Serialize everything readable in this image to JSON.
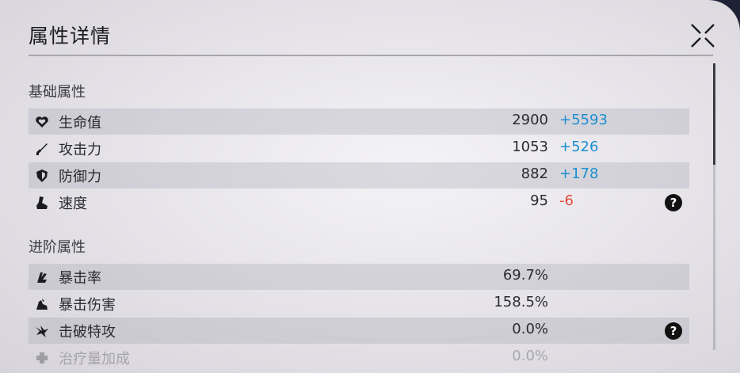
{
  "panel": {
    "title": "属性详情",
    "close_icon": "close-x-icon",
    "scroll_position": 0.0
  },
  "basic": {
    "heading": "基础属性",
    "rows": [
      {
        "label": "生命值",
        "value": "2900",
        "bonus": "+5593",
        "bonus_sign": "pos",
        "icon": "heart-icon",
        "help": false
      },
      {
        "label": "攻击力",
        "value": "1053",
        "bonus": "+526",
        "bonus_sign": "pos",
        "icon": "sword-icon",
        "help": false
      },
      {
        "label": "防御力",
        "value": "882",
        "bonus": "+178",
        "bonus_sign": "pos",
        "icon": "shield-icon",
        "help": false
      },
      {
        "label": "速度",
        "value": "95",
        "bonus": "-6",
        "bonus_sign": "neg",
        "icon": "boot-icon",
        "help": true
      }
    ]
  },
  "advanced": {
    "heading": "进阶属性",
    "rows": [
      {
        "label": "暴击率",
        "value": "69.7%",
        "icon": "crit-rate-icon",
        "help": false
      },
      {
        "label": "暴击伤害",
        "value": "158.5%",
        "icon": "crit-damage-icon",
        "help": false
      },
      {
        "label": "击破特攻",
        "value": "0.0%",
        "icon": "break-effect-icon",
        "help": true
      },
      {
        "label": "治疗量加成",
        "value": "0.0%",
        "icon": "healing-plus-icon",
        "help": false
      }
    ]
  },
  "help_glyph": "?",
  "colors": {
    "positive": "#1d8fcf",
    "negative": "#e04a3b"
  }
}
